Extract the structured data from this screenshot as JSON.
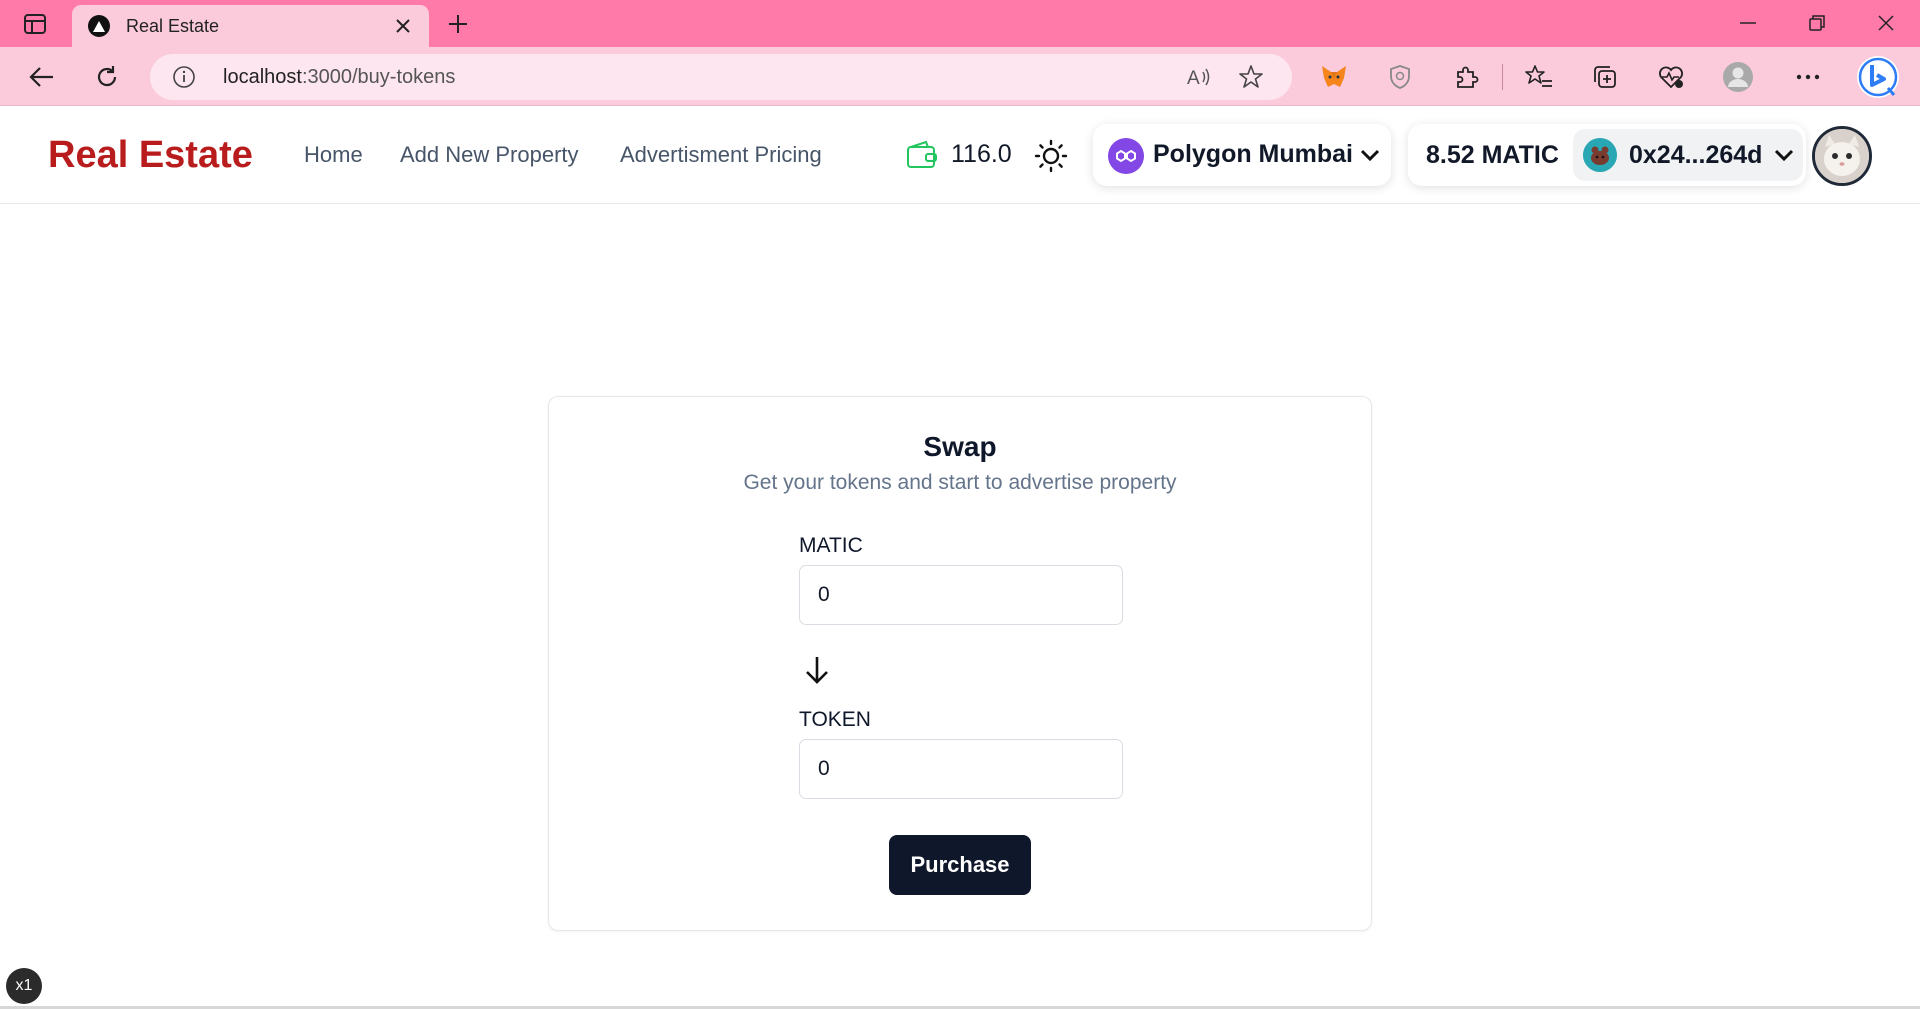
{
  "browser": {
    "tab_title": "Real Estate",
    "url_host": "localhost",
    "url_path": ":3000/buy-tokens"
  },
  "navbar": {
    "brand": "Real Estate",
    "links": [
      "Home",
      "Add New Property",
      "Advertisment Pricing"
    ],
    "token_balance": "116.0",
    "network": "Polygon Mumbai",
    "native_balance": "8.52 MATIC",
    "account_address": "0x24...264d"
  },
  "swap": {
    "title": "Swap",
    "subtitle": "Get your tokens and start to advertise property",
    "from_label": "MATIC",
    "from_value": "0",
    "to_label": "TOKEN",
    "to_value": "0",
    "button": "Purchase"
  },
  "zoom_badge": "x1",
  "colors": {
    "tabbar": "#ff7aa8",
    "toolbar": "#fbcbdc",
    "brand": "#b91c1c",
    "primary_button": "#0f172a",
    "polygon": "#8247e5",
    "wallet_icon": "#22c55e"
  }
}
